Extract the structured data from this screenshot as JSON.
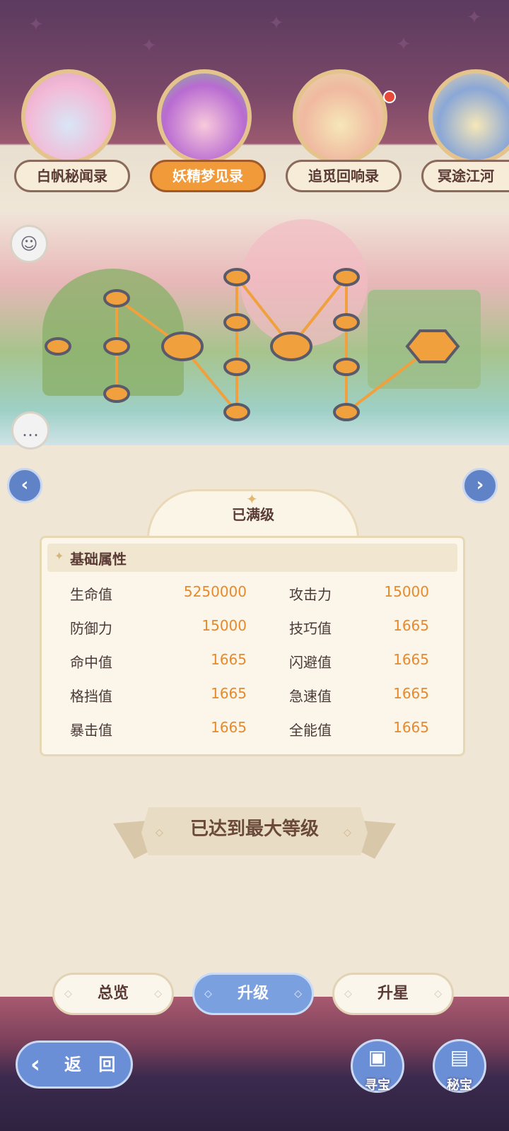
{
  "books": [
    {
      "label": "白帆秘闻录",
      "active": false
    },
    {
      "label": "妖精梦见录",
      "active": true
    },
    {
      "label": "追觅回响录",
      "active": false
    },
    {
      "label": "冥途江河",
      "active": false
    }
  ],
  "panel": {
    "level_status": "已满级",
    "section_title": "基础属性",
    "stats": [
      {
        "name": "生命值",
        "value": "5250000"
      },
      {
        "name": "攻击力",
        "value": "15000"
      },
      {
        "name": "防御力",
        "value": "15000"
      },
      {
        "name": "技巧值",
        "value": "1665"
      },
      {
        "name": "命中值",
        "value": "1665"
      },
      {
        "name": "闪避值",
        "value": "1665"
      },
      {
        "name": "格挡值",
        "value": "1665"
      },
      {
        "name": "急速值",
        "value": "1665"
      },
      {
        "name": "暴击值",
        "value": "1665"
      },
      {
        "name": "全能值",
        "value": "1665"
      }
    ]
  },
  "max_level_text": "已达到最大等级",
  "tabs": [
    {
      "label": "总览",
      "active": false
    },
    {
      "label": "升级",
      "active": true
    },
    {
      "label": "升星",
      "active": false
    }
  ],
  "back_label": "返 回",
  "actions": [
    {
      "label": "寻宝",
      "icon": "treasure-chest-icon"
    },
    {
      "label": "秘宝",
      "icon": "treasure-box-icon"
    }
  ],
  "icons": {
    "robot": "robot-icon",
    "chat": "chat-bubble-icon",
    "prev": "chevron-left-icon",
    "next": "chevron-right-icon"
  },
  "colors": {
    "active_orange": "#f19a3a",
    "stat_value": "#e68a2a",
    "button_blue": "#6b8fd6",
    "node_orange": "#f0a03c"
  }
}
